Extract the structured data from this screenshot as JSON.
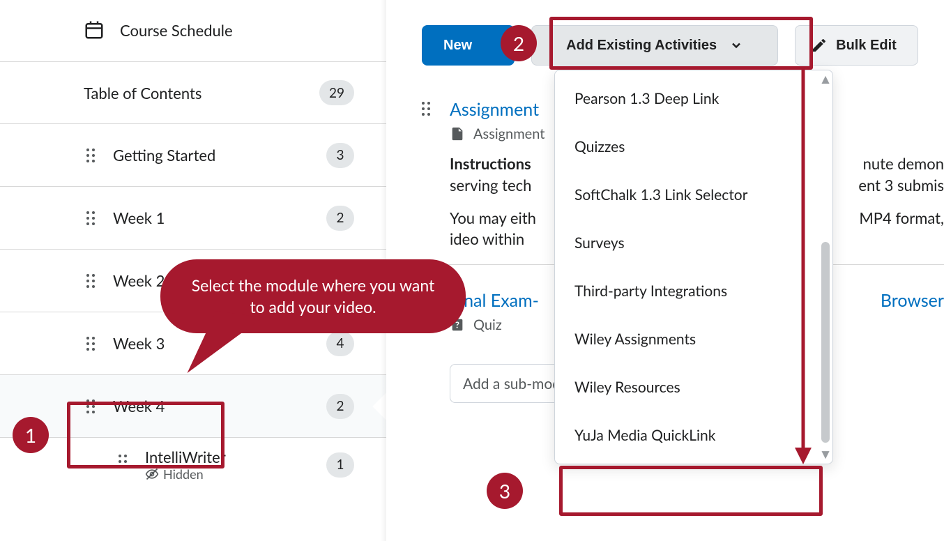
{
  "sidebar": {
    "course_schedule_label": "Course Schedule",
    "toc_label": "Table of Contents",
    "toc_count": "29",
    "items": [
      {
        "label": "Getting Started",
        "count": "3"
      },
      {
        "label": "Week 1",
        "count": "2"
      },
      {
        "label": "Week 2",
        "count": ""
      },
      {
        "label": "Week 3",
        "count": "4"
      },
      {
        "label": "Week 4",
        "count": "2"
      },
      {
        "label": "IntelliWriter",
        "count": "1",
        "hidden_label": "Hidden"
      }
    ]
  },
  "toolbar": {
    "new_label": "New",
    "add_existing_label": "Add Existing Activities",
    "bulk_edit_label": "Bulk Edit"
  },
  "content": {
    "item1": {
      "title_visible": "Assignment ",
      "type_label": "Assignment",
      "instructions_label": "Instructions",
      "line1_tail": "nute demon",
      "line2a": "serving tech",
      "line2b": "ent 3 submis",
      "line3a": "You may eith",
      "line3b": "MP4 format,",
      "line4": "ideo within"
    },
    "item2": {
      "title_a": "Final Exam- ",
      "title_b": "Browser",
      "type_label": "Quiz"
    },
    "sub_module_placeholder": "Add a sub-mod"
  },
  "dropdown": {
    "items": [
      "Pearson 1.3 Deep Link",
      "Quizzes",
      "SoftChalk 1.3 Link Selector",
      "Surveys",
      "Third-party Integrations",
      "Wiley Assignments",
      "Wiley Resources",
      "YuJa Media QuickLink"
    ]
  },
  "annotations": {
    "step1": "1",
    "step2": "2",
    "step3": "3",
    "speech": "Select the module where you want to add your video."
  }
}
